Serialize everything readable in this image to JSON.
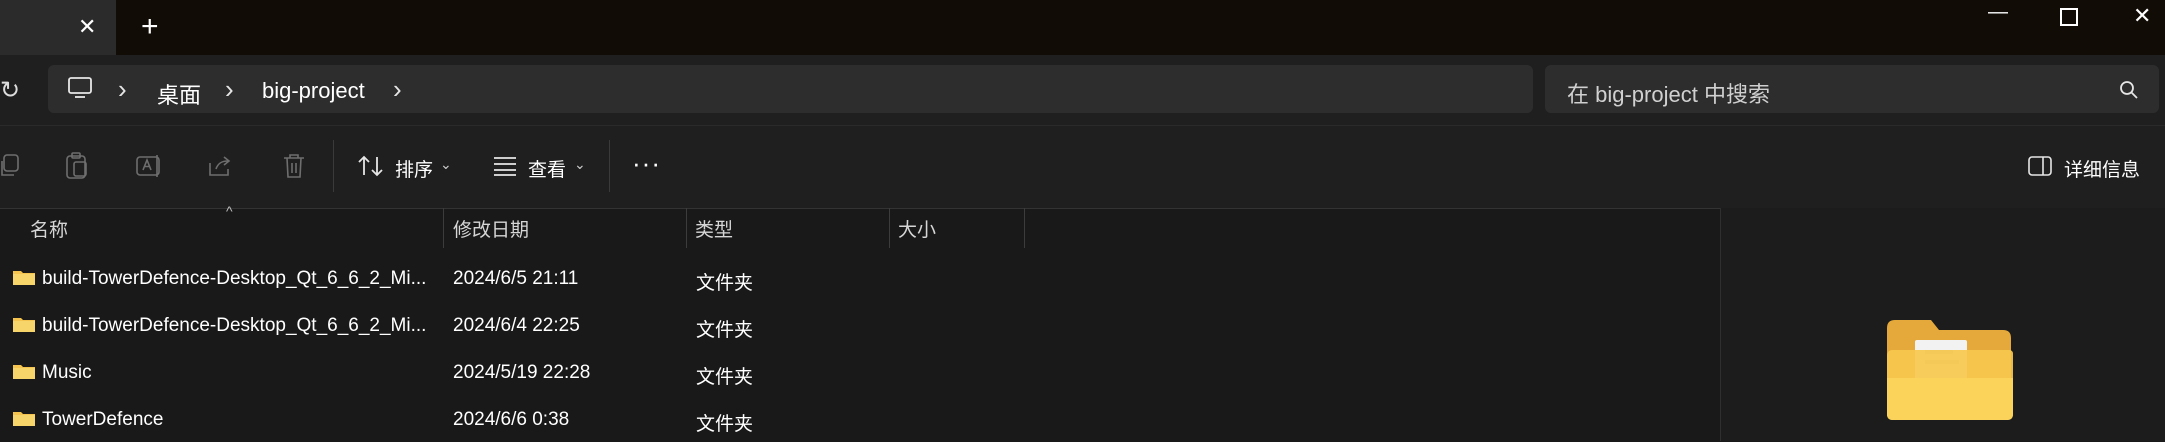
{
  "window": {
    "tab_close": "✕",
    "new_tab": "+",
    "minimize": "—",
    "maximize": "☐",
    "close": "✕"
  },
  "address": {
    "crumbs": [
      "桌面",
      "big-project"
    ],
    "search_placeholder": "在 big-project 中搜索"
  },
  "commands": {
    "sort": "排序",
    "view": "查看",
    "more": "···",
    "details": "详细信息"
  },
  "columns": {
    "name": "名称",
    "modified": "修改日期",
    "type": "类型",
    "size": "大小"
  },
  "files": [
    {
      "name": "build-TowerDefence-Desktop_Qt_6_6_2_Mi...",
      "modified": "2024/6/5 21:11",
      "type": "文件夹"
    },
    {
      "name": "build-TowerDefence-Desktop_Qt_6_6_2_Mi...",
      "modified": "2024/6/4 22:25",
      "type": "文件夹"
    },
    {
      "name": "Music",
      "modified": "2024/5/19 22:28",
      "type": "文件夹"
    },
    {
      "name": "TowerDefence",
      "modified": "2024/6/6 0:38",
      "type": "文件夹"
    }
  ],
  "icons": {
    "folder_color": "#f4c44e",
    "folder_dark": "#e4a93a"
  }
}
